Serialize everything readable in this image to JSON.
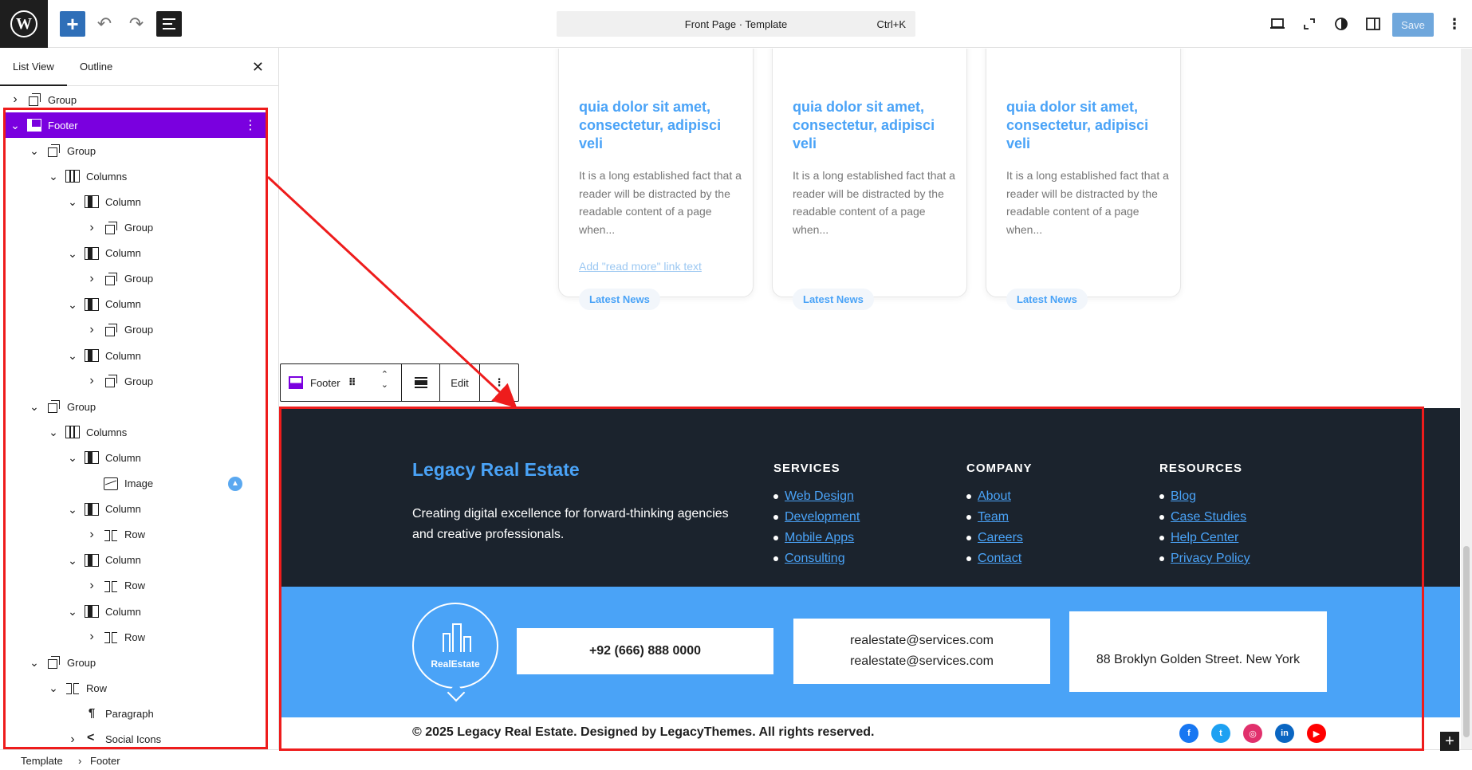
{
  "topbar": {
    "logo_glyph": "W",
    "command_title": "Front Page · Template",
    "command_shortcut": "Ctrl+K",
    "save_label": "Save"
  },
  "sidebar": {
    "tabs": [
      "List View",
      "Outline"
    ],
    "tree": [
      {
        "label": "Group",
        "icon": "group-icon",
        "depth": 0,
        "chevron": "right"
      },
      {
        "label": "Footer",
        "icon": "footer-icon",
        "depth": 0,
        "chevron": "down",
        "selected": true
      },
      {
        "label": "Group",
        "icon": "group-icon",
        "depth": 1,
        "chevron": "down"
      },
      {
        "label": "Columns",
        "icon": "columns-icon",
        "depth": 2,
        "chevron": "down"
      },
      {
        "label": "Column",
        "icon": "column-icon",
        "depth": 3,
        "chevron": "down"
      },
      {
        "label": "Group",
        "icon": "group-icon",
        "depth": 4,
        "chevron": "right"
      },
      {
        "label": "Column",
        "icon": "column-icon",
        "depth": 3,
        "chevron": "down"
      },
      {
        "label": "Group",
        "icon": "group-icon",
        "depth": 4,
        "chevron": "right"
      },
      {
        "label": "Column",
        "icon": "column-icon",
        "depth": 3,
        "chevron": "down"
      },
      {
        "label": "Group",
        "icon": "group-icon",
        "depth": 4,
        "chevron": "right"
      },
      {
        "label": "Column",
        "icon": "column-icon",
        "depth": 3,
        "chevron": "down"
      },
      {
        "label": "Group",
        "icon": "group-icon",
        "depth": 4,
        "chevron": "right"
      },
      {
        "label": "Group",
        "icon": "group-icon",
        "depth": 1,
        "chevron": "down"
      },
      {
        "label": "Columns",
        "icon": "columns-icon",
        "depth": 2,
        "chevron": "down"
      },
      {
        "label": "Column",
        "icon": "column-icon",
        "depth": 3,
        "chevron": "down"
      },
      {
        "label": "Image",
        "icon": "image-icon",
        "depth": 4,
        "chevron": "none",
        "badge": true
      },
      {
        "label": "Column",
        "icon": "column-icon",
        "depth": 3,
        "chevron": "down"
      },
      {
        "label": "Row",
        "icon": "row-icon",
        "depth": 4,
        "chevron": "right"
      },
      {
        "label": "Column",
        "icon": "column-icon",
        "depth": 3,
        "chevron": "down"
      },
      {
        "label": "Row",
        "icon": "row-icon",
        "depth": 4,
        "chevron": "right"
      },
      {
        "label": "Column",
        "icon": "column-icon",
        "depth": 3,
        "chevron": "down"
      },
      {
        "label": "Row",
        "icon": "row-icon",
        "depth": 4,
        "chevron": "right"
      },
      {
        "label": "Group",
        "icon": "group-icon",
        "depth": 1,
        "chevron": "down"
      },
      {
        "label": "Row",
        "icon": "row-icon",
        "depth": 2,
        "chevron": "down"
      },
      {
        "label": "Paragraph",
        "icon": "paragraph-icon",
        "depth": 3,
        "chevron": "none"
      },
      {
        "label": "Social Icons",
        "icon": "share-icon",
        "depth": 3,
        "chevron": "right"
      }
    ]
  },
  "breadcrumb": [
    "Template",
    "Footer"
  ],
  "cards": [
    {
      "title": "quia dolor sit amet, consectetur, adipisci veli",
      "excerpt": "It is a long established fact that a reader will be distracted by the readable content of a page when...",
      "more": "Add \"read more\" link text",
      "tag": "Latest News"
    },
    {
      "title": "quia dolor sit amet, consectetur, adipisci veli",
      "excerpt": "It is a long established fact that a reader will be distracted by the readable content of a page when...",
      "more": "",
      "tag": "Latest News"
    },
    {
      "title": "quia dolor sit amet, consectetur, adipisci veli",
      "excerpt": "It is a long established fact that a reader will be distracted by the readable content of a page when...",
      "more": "",
      "tag": "Latest News"
    }
  ],
  "block_toolbar": {
    "block_name": "Footer",
    "edit_label": "Edit"
  },
  "footer": {
    "brand": "Legacy Real Estate",
    "description": "Creating digital excellence for forward-thinking agencies and creative professionals.",
    "columns": [
      {
        "heading": "SERVICES",
        "links": [
          "Web Design",
          "Development",
          "Mobile Apps",
          "Consulting"
        ]
      },
      {
        "heading": "COMPANY",
        "links": [
          "About",
          "Team",
          "Careers",
          "Contact"
        ]
      },
      {
        "heading": "RESOURCES",
        "links": [
          "Blog",
          "Case Studies",
          "Help Center",
          "Privacy Policy"
        ]
      }
    ],
    "logo_text": "RealEstate",
    "phone": "+92 (666) 888 0000",
    "emails": [
      "realestate@services.com",
      "realestate@services.com"
    ],
    "address": "88 Broklyn Golden Street. New York",
    "copyright": "© 2025 Legacy Real Estate. Designed by LegacyThemes. All rights reserved.",
    "social": [
      {
        "name": "facebook",
        "glyph": "f",
        "color": "#1877f2"
      },
      {
        "name": "twitter",
        "glyph": "t",
        "color": "#1da1f2"
      },
      {
        "name": "instagram",
        "glyph": "◎",
        "color": "#e1306c"
      },
      {
        "name": "linkedin",
        "glyph": "in",
        "color": "#0a66c2"
      },
      {
        "name": "youtube",
        "glyph": "▶",
        "color": "#ff0000"
      }
    ]
  },
  "colors": {
    "accent": "#4aa3f7",
    "selection": "#7a00df",
    "footer_dark": "#1b232d",
    "annotation": "#ee1c1c"
  }
}
